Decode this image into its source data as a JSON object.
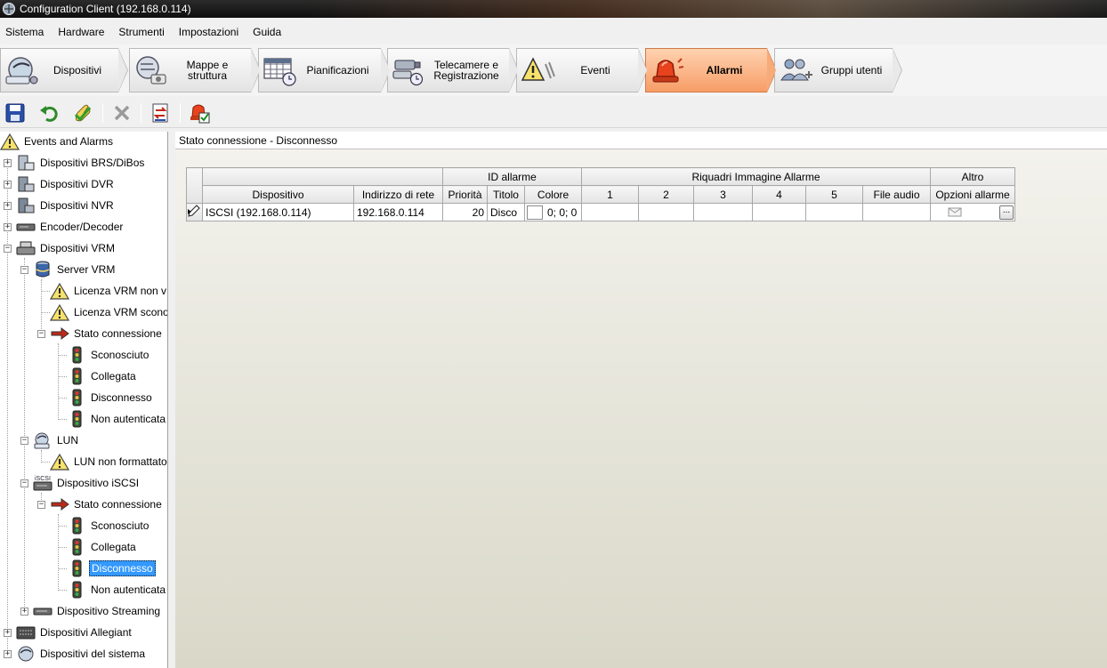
{
  "window": {
    "title": "Configuration Client (192.168.0.114)"
  },
  "menu": [
    "Sistema",
    "Hardware",
    "Strumenti",
    "Impostazioni",
    "Guida"
  ],
  "ribbon": {
    "tabs": [
      {
        "label": "Dispositivi",
        "icon": "devices-icon"
      },
      {
        "label": "Mappe e struttura",
        "icon": "maps-icon"
      },
      {
        "label": "Pianificazioni",
        "icon": "schedule-icon"
      },
      {
        "label": "Telecamere e\nRegistrazione",
        "icon": "camera-recording-icon"
      },
      {
        "label": "Eventi",
        "icon": "events-icon"
      },
      {
        "label": "Allarmi",
        "icon": "alarm-icon",
        "active": true
      },
      {
        "label": "Gruppi utenti",
        "icon": "user-groups-icon"
      }
    ],
    "accent": "#f79d67"
  },
  "tree": {
    "root": "Events and Alarms",
    "items": {
      "brs": "Dispositivi BRS/DiBos",
      "dvr": "Dispositivi DVR",
      "nvr": "Dispositivi NVR",
      "encdec": "Encoder/Decoder",
      "vrm": "Dispositivi VRM",
      "server_vrm": "Server VRM",
      "lic1": "Licenza VRM non v",
      "lic2": "Licenza VRM scono",
      "stato1": "Stato connessione",
      "s1_unknown": "Sconosciuto",
      "s1_connected": "Collegata",
      "s1_disconnected": "Disconnesso",
      "s1_noauth": "Non autenticata",
      "lun": "LUN",
      "lun_unformatted": "LUN non formattato",
      "iscsi": "Dispositivo iSCSI",
      "iscsi_icon_text": "iSCSI",
      "stato2": "Stato connessione",
      "s2_unknown": "Sconosciuto",
      "s2_connected": "Collegata",
      "s2_disconnected": "Disconnesso",
      "s2_noauth": "Non autenticata",
      "streaming": "Dispositivo Streaming",
      "allegiant": "Dispositivi Allegiant",
      "system": "Dispositivi del sistema"
    }
  },
  "main": {
    "header": "Stato connessione - Disconnesso",
    "grid": {
      "groups": {
        "id_allarme": "ID allarme",
        "riquadri": "Riquadri Immagine Allarme",
        "altro": "Altro"
      },
      "columns": {
        "dispositivo": "Dispositivo",
        "indirizzo": "Indirizzo di rete",
        "priorita": "Priorità",
        "titolo": "Titolo",
        "colore": "Colore",
        "q1": "1",
        "q2": "2",
        "q3": "3",
        "q4": "4",
        "q5": "5",
        "audio": "File audio",
        "opzioni": "Opzioni allarme"
      },
      "row": {
        "dispositivo": "ISCSI (192.168.0.114)",
        "indirizzo": "192.168.0.114",
        "priorita": "20",
        "titolo": "Disco",
        "colore": "0; 0; 0",
        "ellipsis": "..."
      }
    }
  }
}
